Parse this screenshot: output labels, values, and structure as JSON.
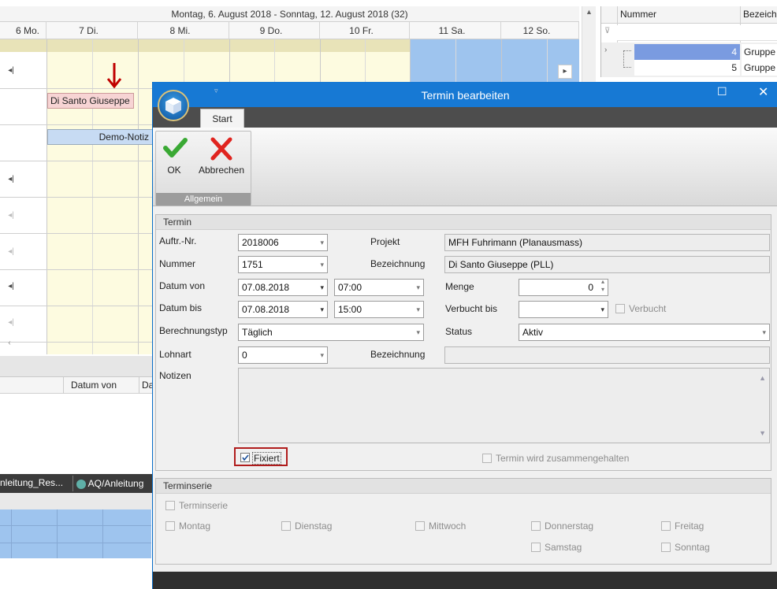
{
  "calendar": {
    "header": "Montag, 6. August 2018 - Sonntag, 12. August 2018 (32)",
    "days": [
      "6 Mo.",
      "7 Di.",
      "8 Mi.",
      "9 Do.",
      "10 Fr.",
      "11 Sa.",
      "12 So."
    ],
    "appointment": "Di Santo Giuseppe",
    "note": "Demo-Notiz"
  },
  "right_grid": {
    "col_number": "Nummer",
    "col_designation": "Bezeichn",
    "rows": [
      {
        "number": "4",
        "group": "Gruppe"
      },
      {
        "number": "5",
        "group": "Gruppe"
      }
    ]
  },
  "lower_left": {
    "col_date_from": "Datum von",
    "col_d": "Da",
    "tab1": "nleitung_Res...",
    "tab2": "AQ/Anleitung"
  },
  "dialog": {
    "title": "Termin bearbeiten",
    "ribbon_tab": "Start",
    "ok_label": "OK",
    "cancel_label": "Abbrechen",
    "group_label": "Allgemein",
    "termin_section": "Termin",
    "fields": {
      "auftr_label": "Auftr.-Nr.",
      "auftr_value": "2018006",
      "projekt_label": "Projekt",
      "projekt_value": "MFH Fuhrimann (Planausmass)",
      "nummer_label": "Nummer",
      "nummer_value": "1751",
      "bezeichnung_label": "Bezeichnung",
      "bezeichnung_value": "Di Santo Giuseppe (PLL)",
      "datum_von_label": "Datum von",
      "datum_von_value": "07.08.2018",
      "zeit_von_value": "07:00",
      "menge_label": "Menge",
      "menge_value": "0",
      "datum_bis_label": "Datum bis",
      "datum_bis_value": "07.08.2018",
      "zeit_bis_value": "15:00",
      "verbucht_bis_label": "Verbucht bis",
      "verbucht_label": "Verbucht",
      "berechnungstyp_label": "Berechnungstyp",
      "berechnungstyp_value": "Täglich",
      "status_label": "Status",
      "status_value": "Aktiv",
      "lohnart_label": "Lohnart",
      "lohnart_value": "0",
      "bezeichnung2_label": "Bezeichnung",
      "notizen_label": "Notizen",
      "fixiert_label": "Fixiert",
      "zusammen_label": "Termin wird zusammengehalten"
    },
    "serie_section": "Terminserie",
    "serie": {
      "terminserie": "Terminserie",
      "montag": "Montag",
      "dienstag": "Dienstag",
      "mittwoch": "Mittwoch",
      "donnerstag": "Donnerstag",
      "freitag": "Freitag",
      "samstag": "Samstag",
      "sonntag": "Sonntag"
    }
  },
  "colors": {
    "titlebar": "#1779d4",
    "weekend": "#9ec4ee",
    "weekday": "#fdfbe0",
    "appointment": "#f7d4d4",
    "highlight_red": "#c00000"
  }
}
